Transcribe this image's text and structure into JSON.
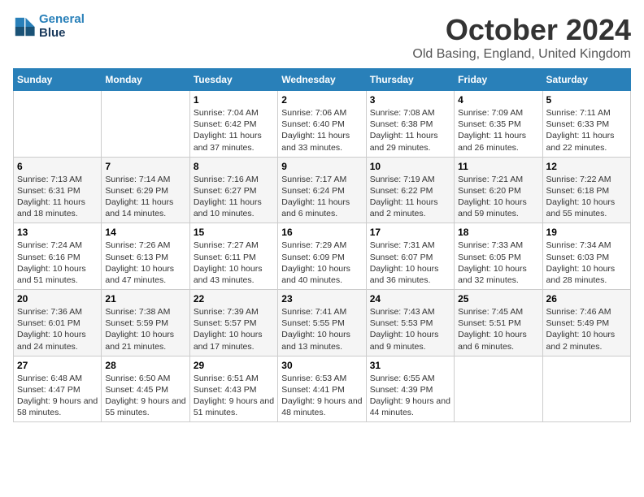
{
  "header": {
    "logo_line1": "General",
    "logo_line2": "Blue",
    "month_title": "October 2024",
    "location": "Old Basing, England, United Kingdom"
  },
  "weekdays": [
    "Sunday",
    "Monday",
    "Tuesday",
    "Wednesday",
    "Thursday",
    "Friday",
    "Saturday"
  ],
  "weeks": [
    [
      {
        "day": "",
        "info": ""
      },
      {
        "day": "",
        "info": ""
      },
      {
        "day": "1",
        "info": "Sunrise: 7:04 AM\nSunset: 6:42 PM\nDaylight: 11 hours and 37 minutes."
      },
      {
        "day": "2",
        "info": "Sunrise: 7:06 AM\nSunset: 6:40 PM\nDaylight: 11 hours and 33 minutes."
      },
      {
        "day": "3",
        "info": "Sunrise: 7:08 AM\nSunset: 6:38 PM\nDaylight: 11 hours and 29 minutes."
      },
      {
        "day": "4",
        "info": "Sunrise: 7:09 AM\nSunset: 6:35 PM\nDaylight: 11 hours and 26 minutes."
      },
      {
        "day": "5",
        "info": "Sunrise: 7:11 AM\nSunset: 6:33 PM\nDaylight: 11 hours and 22 minutes."
      }
    ],
    [
      {
        "day": "6",
        "info": "Sunrise: 7:13 AM\nSunset: 6:31 PM\nDaylight: 11 hours and 18 minutes."
      },
      {
        "day": "7",
        "info": "Sunrise: 7:14 AM\nSunset: 6:29 PM\nDaylight: 11 hours and 14 minutes."
      },
      {
        "day": "8",
        "info": "Sunrise: 7:16 AM\nSunset: 6:27 PM\nDaylight: 11 hours and 10 minutes."
      },
      {
        "day": "9",
        "info": "Sunrise: 7:17 AM\nSunset: 6:24 PM\nDaylight: 11 hours and 6 minutes."
      },
      {
        "day": "10",
        "info": "Sunrise: 7:19 AM\nSunset: 6:22 PM\nDaylight: 11 hours and 2 minutes."
      },
      {
        "day": "11",
        "info": "Sunrise: 7:21 AM\nSunset: 6:20 PM\nDaylight: 10 hours and 59 minutes."
      },
      {
        "day": "12",
        "info": "Sunrise: 7:22 AM\nSunset: 6:18 PM\nDaylight: 10 hours and 55 minutes."
      }
    ],
    [
      {
        "day": "13",
        "info": "Sunrise: 7:24 AM\nSunset: 6:16 PM\nDaylight: 10 hours and 51 minutes."
      },
      {
        "day": "14",
        "info": "Sunrise: 7:26 AM\nSunset: 6:13 PM\nDaylight: 10 hours and 47 minutes."
      },
      {
        "day": "15",
        "info": "Sunrise: 7:27 AM\nSunset: 6:11 PM\nDaylight: 10 hours and 43 minutes."
      },
      {
        "day": "16",
        "info": "Sunrise: 7:29 AM\nSunset: 6:09 PM\nDaylight: 10 hours and 40 minutes."
      },
      {
        "day": "17",
        "info": "Sunrise: 7:31 AM\nSunset: 6:07 PM\nDaylight: 10 hours and 36 minutes."
      },
      {
        "day": "18",
        "info": "Sunrise: 7:33 AM\nSunset: 6:05 PM\nDaylight: 10 hours and 32 minutes."
      },
      {
        "day": "19",
        "info": "Sunrise: 7:34 AM\nSunset: 6:03 PM\nDaylight: 10 hours and 28 minutes."
      }
    ],
    [
      {
        "day": "20",
        "info": "Sunrise: 7:36 AM\nSunset: 6:01 PM\nDaylight: 10 hours and 24 minutes."
      },
      {
        "day": "21",
        "info": "Sunrise: 7:38 AM\nSunset: 5:59 PM\nDaylight: 10 hours and 21 minutes."
      },
      {
        "day": "22",
        "info": "Sunrise: 7:39 AM\nSunset: 5:57 PM\nDaylight: 10 hours and 17 minutes."
      },
      {
        "day": "23",
        "info": "Sunrise: 7:41 AM\nSunset: 5:55 PM\nDaylight: 10 hours and 13 minutes."
      },
      {
        "day": "24",
        "info": "Sunrise: 7:43 AM\nSunset: 5:53 PM\nDaylight: 10 hours and 9 minutes."
      },
      {
        "day": "25",
        "info": "Sunrise: 7:45 AM\nSunset: 5:51 PM\nDaylight: 10 hours and 6 minutes."
      },
      {
        "day": "26",
        "info": "Sunrise: 7:46 AM\nSunset: 5:49 PM\nDaylight: 10 hours and 2 minutes."
      }
    ],
    [
      {
        "day": "27",
        "info": "Sunrise: 6:48 AM\nSunset: 4:47 PM\nDaylight: 9 hours and 58 minutes."
      },
      {
        "day": "28",
        "info": "Sunrise: 6:50 AM\nSunset: 4:45 PM\nDaylight: 9 hours and 55 minutes."
      },
      {
        "day": "29",
        "info": "Sunrise: 6:51 AM\nSunset: 4:43 PM\nDaylight: 9 hours and 51 minutes."
      },
      {
        "day": "30",
        "info": "Sunrise: 6:53 AM\nSunset: 4:41 PM\nDaylight: 9 hours and 48 minutes."
      },
      {
        "day": "31",
        "info": "Sunrise: 6:55 AM\nSunset: 4:39 PM\nDaylight: 9 hours and 44 minutes."
      },
      {
        "day": "",
        "info": ""
      },
      {
        "day": "",
        "info": ""
      }
    ]
  ]
}
